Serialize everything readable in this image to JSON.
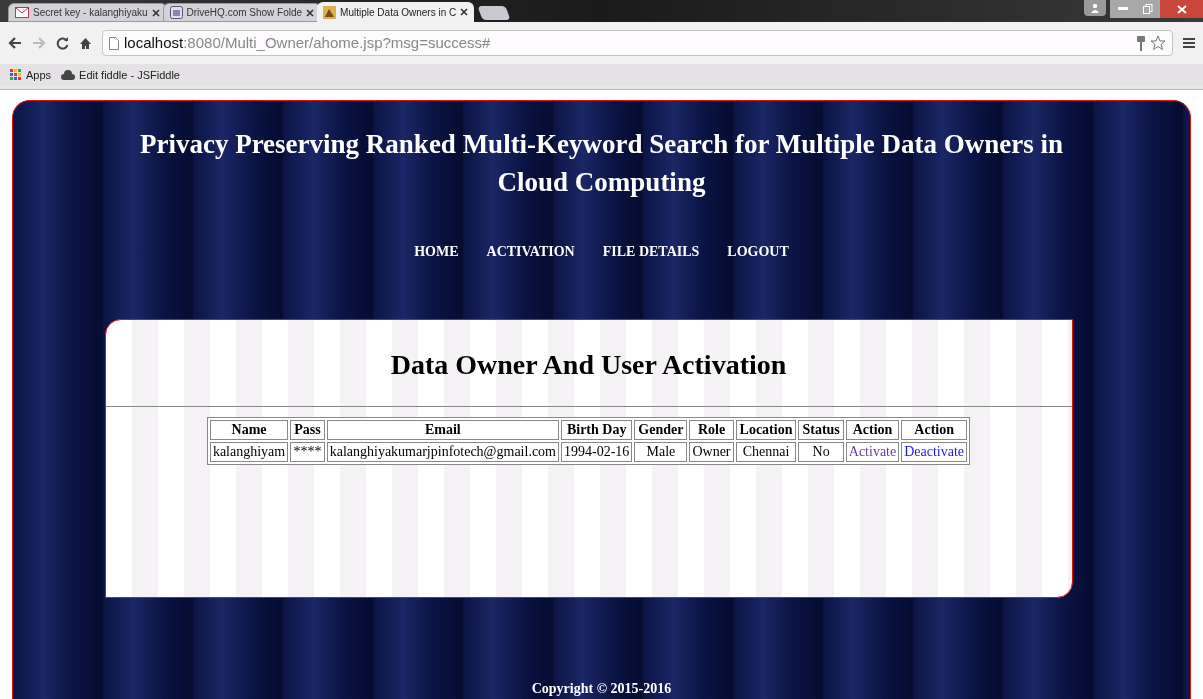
{
  "browser": {
    "tabs": [
      {
        "label": "Secret key - kalanghiyaku",
        "selected": false
      },
      {
        "label": "DriveHQ.com Show Folde",
        "selected": false
      },
      {
        "label": "Multiple Data Owners in C",
        "selected": true
      }
    ],
    "address": {
      "host": "localhost",
      "path": ":8080/Multi_Owner/ahome.jsp?msg=success#"
    },
    "bookmarks": [
      {
        "label": "Apps"
      },
      {
        "label": "Edit fiddle - JSFiddle"
      }
    ]
  },
  "page": {
    "title": "Privacy Preserving Ranked Multi-Keyword Search for Multiple Data Owners in Cloud Computing",
    "nav": [
      "HOME",
      "ACTIVATION",
      "FILE DETAILS",
      "LOGOUT"
    ],
    "heading": "Data Owner And User Activation",
    "table": {
      "columns": [
        "Name",
        "Pass",
        "Email",
        "Birth Day",
        "Gender",
        "Role",
        "Location",
        "Status",
        "Action",
        "Action"
      ],
      "rows": [
        {
          "cells": [
            {
              "text": "kalanghiyam"
            },
            {
              "text": "****"
            },
            {
              "text": "kalanghiyakumarjpinfotech@gmail.com"
            },
            {
              "text": "1994-02-16"
            },
            {
              "text": "Male"
            },
            {
              "text": "Owner"
            },
            {
              "text": "Chennai"
            },
            {
              "text": "No"
            },
            {
              "text": "Activate",
              "kind": "link",
              "visited": true
            },
            {
              "text": "Deactivate",
              "kind": "link",
              "visited": false
            }
          ]
        }
      ]
    },
    "footer": "Copyright © 2015-2016"
  }
}
